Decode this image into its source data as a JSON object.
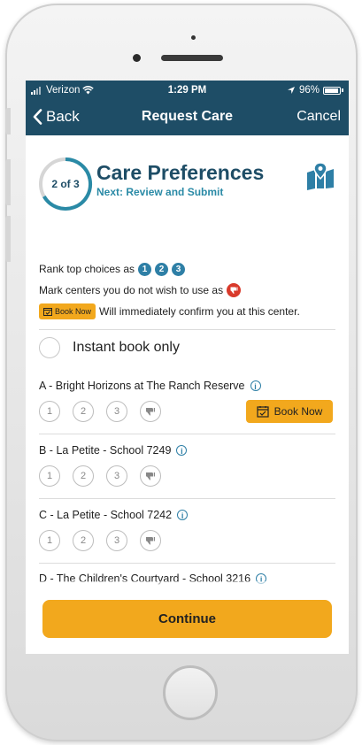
{
  "status_bar": {
    "carrier": "Verizon",
    "time": "1:29 PM",
    "battery": "96%"
  },
  "navbar": {
    "back_label": "Back",
    "title": "Request Care",
    "cancel_label": "Cancel"
  },
  "header": {
    "step": "2 of 3",
    "title": "Care Preferences",
    "subtitle": "Next: Review and Submit"
  },
  "info": {
    "rank_text": "Rank top choices as",
    "rank_numbers": [
      "1",
      "2",
      "3"
    ],
    "mark_text": "Mark centers you do not wish to use as",
    "book_now_small": "Book Now",
    "book_text": "Will immediately confirm you at this center."
  },
  "instant_book": {
    "label": "Instant book only"
  },
  "centers": [
    {
      "name": "A - Bright Horizons at The Ranch Reserve",
      "book_label": "Book Now"
    },
    {
      "name": "B - La Petite - School 7249"
    },
    {
      "name": "C - La Petite - School 7242"
    },
    {
      "name": "D - The Children's Courtyard - School 3216"
    }
  ],
  "rank_labels": [
    "1",
    "2",
    "3"
  ],
  "continue_label": "Continue",
  "colors": {
    "navbar": "#1e4d66",
    "accent": "#f2a81d",
    "rank_blue": "#2e7fa6",
    "decline_red": "#d93a2b"
  }
}
